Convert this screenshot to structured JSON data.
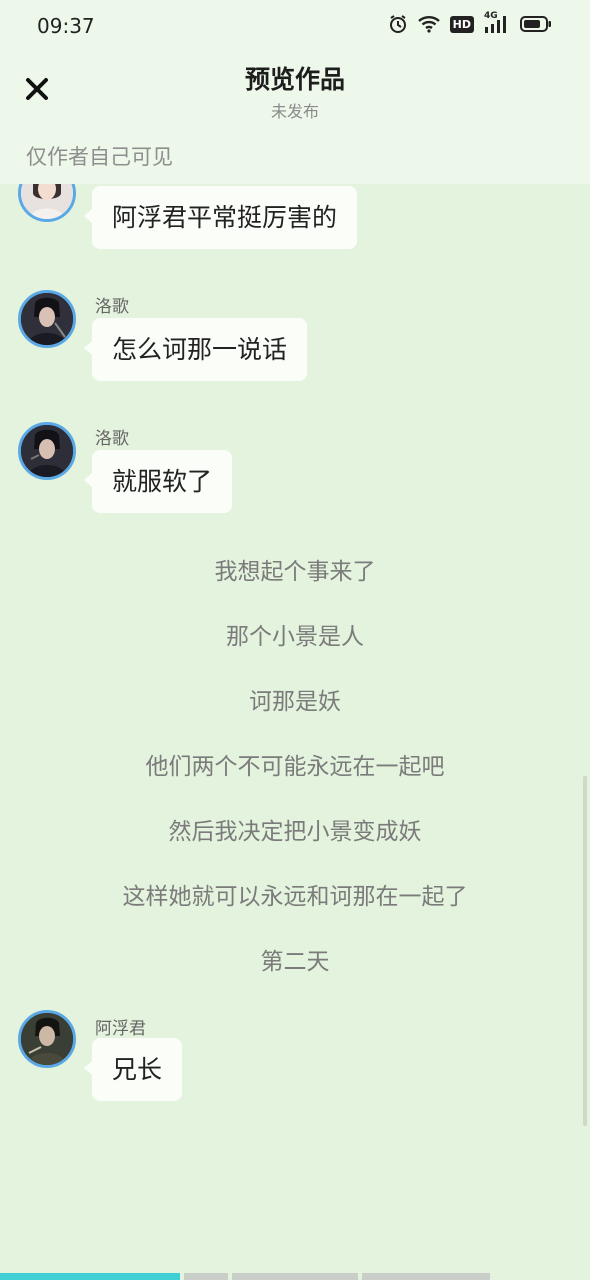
{
  "status_bar": {
    "time": "09:37",
    "icons": [
      "alarm-icon",
      "wifi-icon",
      "hd-icon",
      "signal-4g-icon",
      "battery-icon"
    ],
    "network_label": "4G",
    "hd_label": "HD"
  },
  "header": {
    "title": "预览作品",
    "subtitle": "未发布",
    "close_icon": "close-icon"
  },
  "visibility_note": "仅作者自己可见",
  "messages": [
    {
      "speaker": "",
      "text": "阿浮君平常挺厉害的"
    },
    {
      "speaker": "洛歌",
      "text": "怎么诃那一说话"
    },
    {
      "speaker": "洛歌",
      "text": "就服软了"
    },
    {
      "speaker": "阿浮君",
      "text": "兄长"
    }
  ],
  "narration": [
    "我想起个事来了",
    "那个小景是人",
    "诃那是妖",
    "他们两个不可能永远在一起吧",
    "然后我决定把小景变成妖",
    "这样她就可以永远和诃那在一起了",
    "第二天"
  ],
  "progress": {
    "segments": 4,
    "current_segment": 1,
    "current_fraction": 1.0
  },
  "colors": {
    "background": "#e3f3dd",
    "header_bg": "#edf8ea",
    "avatar_ring": "#5aa9e6",
    "progress_active": "#3fcfd4",
    "progress_track": "#c9cec8"
  }
}
